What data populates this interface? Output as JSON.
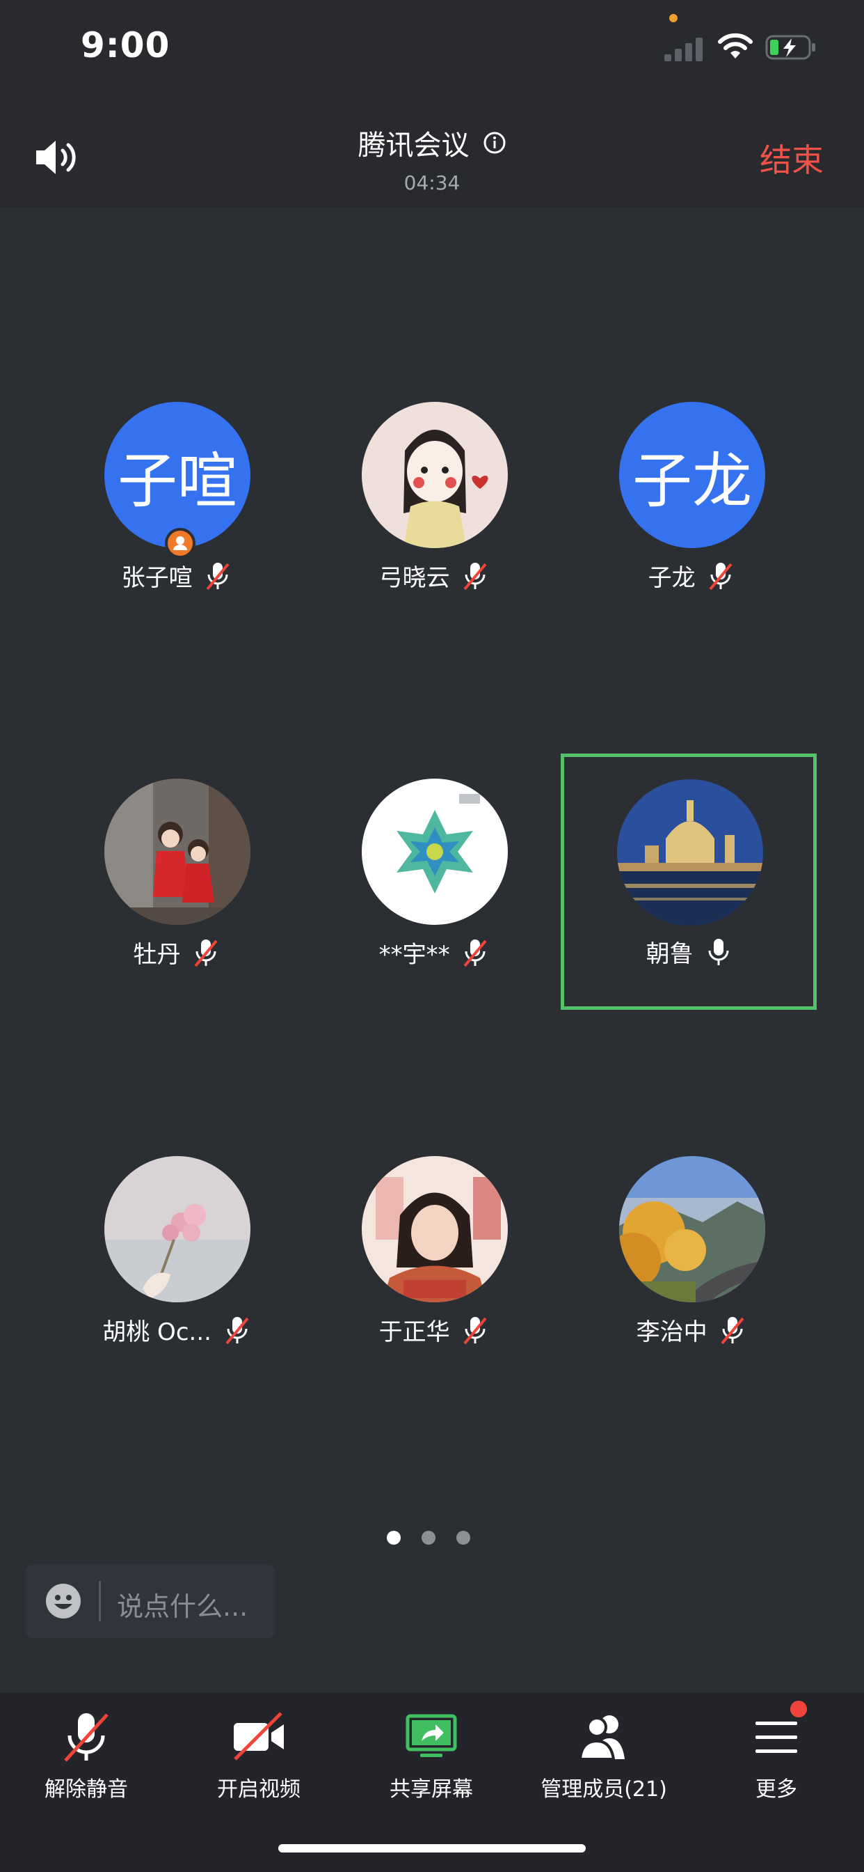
{
  "status_bar": {
    "time": "9:00"
  },
  "header": {
    "title": "腾讯会议",
    "duration": "04:34",
    "end_label": "结束"
  },
  "participants": [
    {
      "name": "张子喧",
      "avatar_text": "子喧",
      "host": true,
      "muted": true
    },
    {
      "name": "弓晓云",
      "avatar_text": "",
      "muted": true
    },
    {
      "name": "子龙",
      "avatar_text": "子龙",
      "muted": true
    },
    {
      "name": "牡丹",
      "avatar_text": "",
      "muted": true
    },
    {
      "name": "**宇**",
      "avatar_text": "",
      "muted": true
    },
    {
      "name": "朝鲁",
      "avatar_text": "",
      "muted": false,
      "active": true
    },
    {
      "name": "胡桃 Oc...",
      "avatar_text": "",
      "muted": true
    },
    {
      "name": "于正华",
      "avatar_text": "",
      "muted": true
    },
    {
      "name": "李治中",
      "avatar_text": "",
      "muted": true
    }
  ],
  "pager": {
    "pages": 3,
    "current": 1
  },
  "chat": {
    "placeholder": "说点什么..."
  },
  "toolbar": {
    "unmute": "解除静音",
    "video": "开启视频",
    "share": "共享屏幕",
    "members": "管理成员(21)",
    "more": "更多"
  },
  "colors": {
    "accent_red": "#f0524a",
    "avatar_blue": "#3472f0",
    "speaking_green": "#53c26a",
    "share_green": "#3fbf5f"
  }
}
